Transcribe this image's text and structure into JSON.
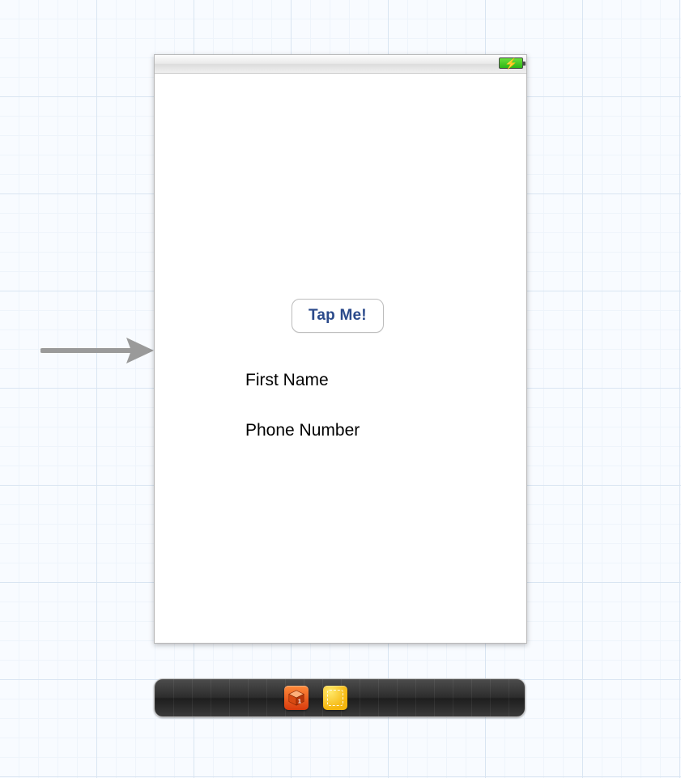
{
  "view": {
    "button_label": "Tap Me!",
    "first_name_label": "First Name",
    "phone_number_label": "Phone Number"
  },
  "statusbar": {
    "battery_state": "charging"
  },
  "dock": {
    "items": [
      {
        "name": "first-responder-cube-icon"
      },
      {
        "name": "exit-scene-icon"
      }
    ]
  }
}
